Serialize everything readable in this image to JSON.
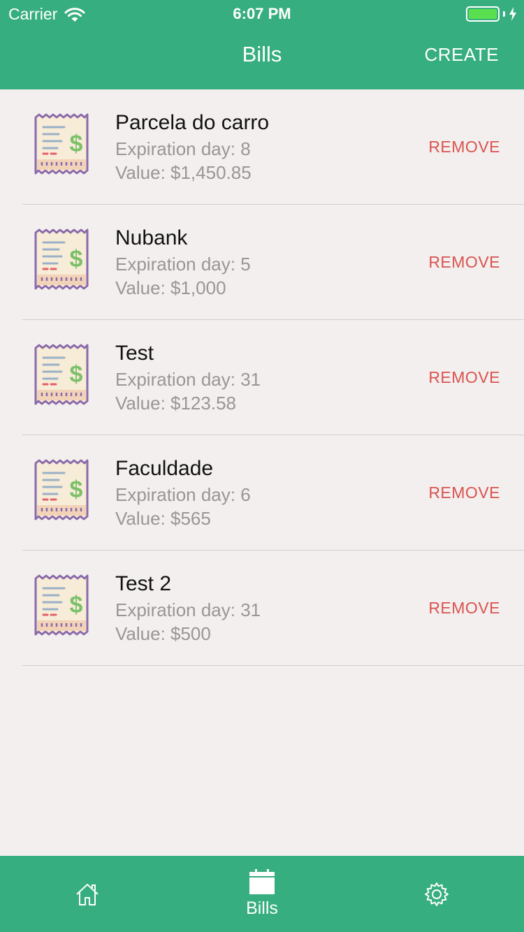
{
  "status_bar": {
    "carrier": "Carrier",
    "time": "6:07 PM",
    "battery_color": "#5ae04f"
  },
  "nav": {
    "title": "Bills",
    "action_label": "CREATE",
    "background": "#37ae7f"
  },
  "bills": [
    {
      "name": "Parcela do carro",
      "expiration": "Expiration day: 8",
      "value": "Value: $1,450.85",
      "remove_label": "REMOVE",
      "icon": "receipt-icon"
    },
    {
      "name": "Nubank",
      "expiration": "Expiration day: 5",
      "value": "Value: $1,000",
      "remove_label": "REMOVE",
      "icon": "receipt-icon"
    },
    {
      "name": "Test",
      "expiration": "Expiration day: 31",
      "value": "Value: $123.58",
      "remove_label": "REMOVE",
      "icon": "receipt-icon"
    },
    {
      "name": "Faculdade",
      "expiration": "Expiration day: 6",
      "value": "Value: $565",
      "remove_label": "REMOVE",
      "icon": "receipt-icon"
    },
    {
      "name": "Test 2",
      "expiration": "Expiration day: 31",
      "value": "Value: $500",
      "remove_label": "REMOVE",
      "icon": "receipt-icon"
    }
  ],
  "tabbar": {
    "tabs": [
      {
        "icon": "home-icon",
        "label": ""
      },
      {
        "icon": "calendar-icon",
        "label": "Bills",
        "selected": true
      },
      {
        "icon": "gear-icon",
        "label": ""
      }
    ]
  },
  "colors": {
    "accent": "#37ae7f",
    "remove": "#d9534f",
    "background": "#f3efee"
  }
}
